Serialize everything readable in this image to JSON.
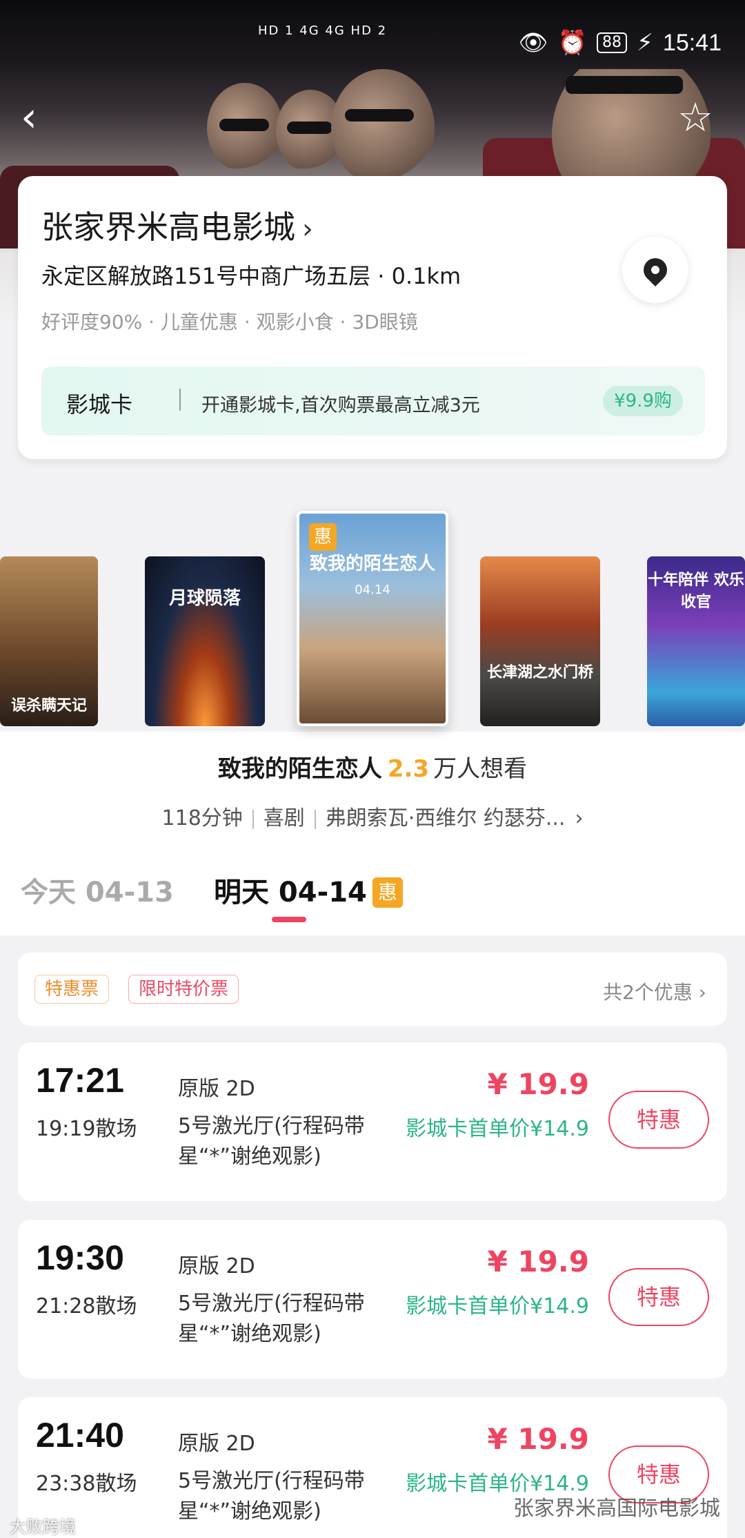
{
  "status_bar": {
    "network": "HD 1 4G 4G HD 2",
    "battery": "88",
    "time": "15:41"
  },
  "header": {
    "back_icon": "chevron-left-icon",
    "favorite_icon": "star-outline-icon"
  },
  "cinema": {
    "name": "张家界米高电影城",
    "address": "永定区解放路151号中商广场五层 · 0.1km",
    "tags": "好评度90% · 儿童优惠 · 观影小食 · 3D眼镜",
    "card_label": "影城卡",
    "card_desc": "开通影城卡,首次购票最高立减3元",
    "card_buy": "¥9.9购"
  },
  "posters": {
    "p1_text": "误杀瞒天记",
    "p2_text": "月球陨落",
    "p3_text": "致我的陌生恋人",
    "p3_date": "04.14",
    "p3_badge": "惠",
    "p4_text": "长津湖之水门桥",
    "p5_text": "十年陪伴 欢乐收官"
  },
  "movie": {
    "title": "致我的陌生恋人",
    "want_count": "2.3",
    "want_label": "万人想看",
    "duration": "118分钟",
    "genre": "喜剧",
    "cast": "弗朗索瓦·西维尔  约瑟芬..."
  },
  "dates": {
    "today": "今天 04-13",
    "tomorrow": "明天 04-14",
    "tomorrow_badge": "惠"
  },
  "promo": {
    "tag1": "特惠票",
    "tag2": "限时特价票",
    "more": "共2个优惠 ›"
  },
  "showtimes": [
    {
      "start": "17:21",
      "end": "19:19散场",
      "version": "原版 2D",
      "hall": "5号激光厅(行程码带星“*”谢绝观影)",
      "price": "¥ 19.9",
      "card_price": "影城卡首单价¥14.9",
      "button": "特惠"
    },
    {
      "start": "19:30",
      "end": "21:28散场",
      "version": "原版 2D",
      "hall": "5号激光厅(行程码带星“*”谢绝观影)",
      "price": "¥ 19.9",
      "card_price": "影城卡首单价¥14.9",
      "button": "特惠"
    },
    {
      "start": "21:40",
      "end": "23:38散场",
      "version": "原版 2D",
      "hall": "5号激光厅(行程码带星“*”谢绝观影)",
      "price": "¥ 19.9",
      "card_price": "影城卡首单价¥14.9",
      "button": "特惠"
    }
  ],
  "watermarks": {
    "left": "大败跨境",
    "right": "张家界米高国际电影城"
  },
  "colors": {
    "accent": "#ef4461",
    "card_green": "#2bb48a",
    "badge_orange": "#f5a623"
  }
}
